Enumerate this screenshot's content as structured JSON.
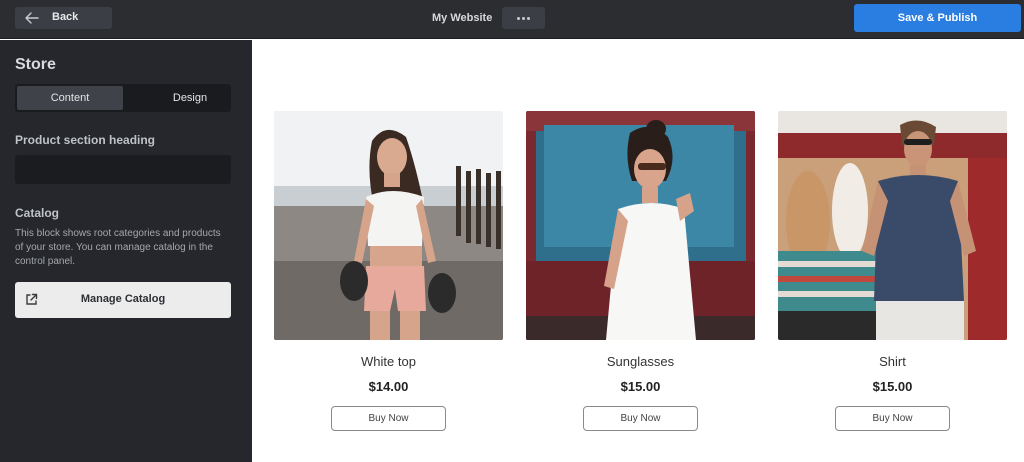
{
  "topbar": {
    "back_label": "Back",
    "site_title": "My Website",
    "more_label": "•••",
    "publish_label": "Save & Publish",
    "accent_color": "#2a7de1"
  },
  "sidebar": {
    "title": "Store",
    "tabs": [
      {
        "label": "Content",
        "active": true
      },
      {
        "label": "Design",
        "active": false
      }
    ],
    "heading_field": {
      "label": "Product section heading",
      "value": "",
      "placeholder": ""
    },
    "catalog": {
      "title": "Catalog",
      "description": "This block shows root categories and products of your store. You can manage catalog in the control panel.",
      "manage_label": "Manage Catalog",
      "manage_icon": "external-link-icon"
    }
  },
  "products": [
    {
      "name": "White top",
      "price": "$14.00",
      "button": "Buy Now",
      "image": "photo-woman-white-top-beach"
    },
    {
      "name": "Sunglasses",
      "price": "$15.00",
      "button": "Buy Now",
      "image": "photo-woman-sunglasses-truck"
    },
    {
      "name": "Shirt",
      "price": "$15.00",
      "button": "Buy Now",
      "image": "photo-man-shirt-surfboards"
    }
  ]
}
